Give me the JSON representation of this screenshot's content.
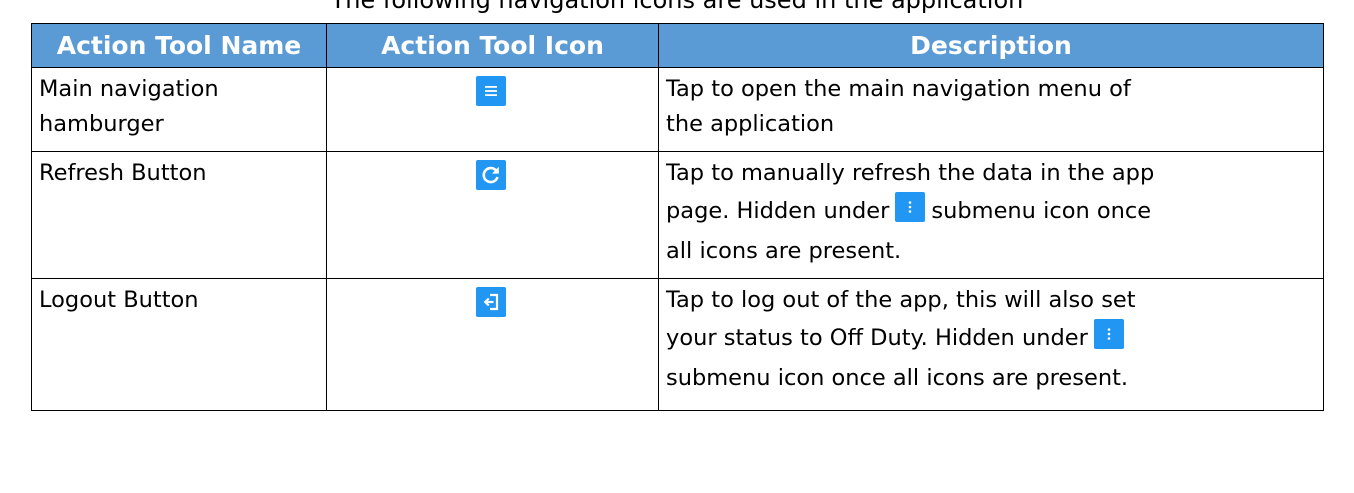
{
  "caption": "The following navigation icons are used in the application",
  "table": {
    "headers": [
      "Action Tool Name",
      "Action Tool Icon",
      "Description"
    ],
    "rows": [
      {
        "name_lines": [
          "Main navigation",
          "hamburger"
        ],
        "icon": "hamburger-menu-icon",
        "desc_lines": [
          "Tap to open the main navigation menu of",
          "the application"
        ]
      },
      {
        "name_lines": [
          "Refresh Button"
        ],
        "icon": "refresh-icon",
        "desc_l1": "Tap to manually refresh the data in the app",
        "desc_l2_before": "page. Hidden under",
        "desc_l2_after": "submenu icon once",
        "desc_l3": "all icons are present.",
        "inline_icon": "more-vertical-icon"
      },
      {
        "name_lines": [
          "Logout Button"
        ],
        "icon": "logout-icon",
        "desc_l1": "Tap to log out of the app, this will also set",
        "desc_l2_before": "your status to Off Duty. Hidden under",
        "desc_l3": "submenu icon once all icons are present.",
        "inline_icon": "more-vertical-icon"
      }
    ]
  },
  "colors": {
    "header_bg": "#5b9bd5",
    "header_text": "#ffffff",
    "icon_bg": "#2196f3"
  }
}
